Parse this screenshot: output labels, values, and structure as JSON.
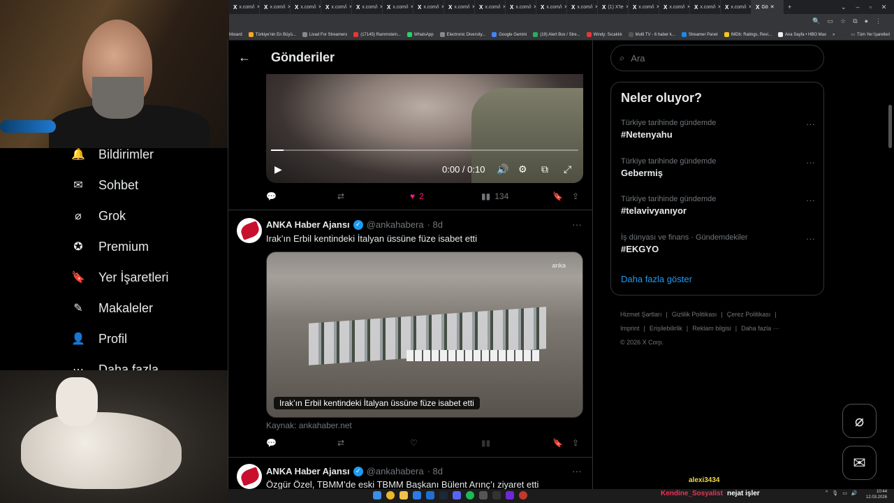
{
  "browser": {
    "tabs": [
      "x.com/i",
      "x.com/i",
      "x.com/i",
      "x.com/i",
      "x.com/i",
      "x.com/i",
      "x.com/i",
      "x.com/i",
      "x.com/i",
      "x.com/i",
      "x.com/i",
      "x.com/i",
      "(1) X'te",
      "x.com/i",
      "x.com/i",
      "x.com/i",
      "x.com/i",
      "Gö"
    ],
    "new_tab": "+",
    "bookmarks": [
      "hboard",
      "Türkiye'nin En Büyü...",
      "Livad For Streamers",
      "(17145) Rammstein...",
      "WhatsApp",
      "Electronic Diversity...",
      "Google Gemini",
      "(19) Alert Box / Stre...",
      "Windy: Sıcaklık",
      "Multi TV - 6 haber k...",
      "Streamer Panel",
      "IMDb: Ratings, Revi...",
      "Ana Sayfa • HBO Max"
    ],
    "bookmarks_more": "»",
    "all_bookmarks": "Tüm Yer İşaretleri"
  },
  "sidebar": {
    "items": [
      {
        "label": "Bildirimler",
        "icon": "bell-icon"
      },
      {
        "label": "Sohbet",
        "icon": "mail-icon"
      },
      {
        "label": "Grok",
        "icon": "grok-icon"
      },
      {
        "label": "Premium",
        "icon": "premium-icon"
      },
      {
        "label": "Yer İşaretleri",
        "icon": "bookmark-icon"
      },
      {
        "label": "Makaleler",
        "icon": "article-icon"
      },
      {
        "label": "Profil",
        "icon": "person-icon"
      },
      {
        "label": "Daha fazla",
        "icon": "more-icon"
      }
    ]
  },
  "header": {
    "title": "Gönderiler"
  },
  "video_post": {
    "time": "0:00 / 0:10",
    "progress": 0.04,
    "likes": "2",
    "views": "134",
    "like_color": "#f91880"
  },
  "post1": {
    "name": "ANKA Haber Ajansı",
    "handle": "@ankahabera",
    "age": "· 8d",
    "text": "Irak’ın Erbil kentindeki İtalyan üssüne füze isabet etti",
    "card_logo": "anka",
    "card_caption": "Irak’ın Erbil kentindeki İtalyan üssüne füze isabet etti",
    "source": "Kaynak: ankahaber.net"
  },
  "post2": {
    "name": "ANKA Haber Ajansı",
    "handle": "@ankahabera",
    "age": "· 8d",
    "text": "Özgür Özel, TBMM’de eski TBMM Başkanı Bülent Arınç’ı ziyaret etti"
  },
  "search": {
    "placeholder": "Ara"
  },
  "trends": {
    "title": "Neler oluyor?",
    "items": [
      {
        "context": "Türkiye tarihinde gündemde",
        "topic": "#Netenyahu"
      },
      {
        "context": "Türkiye tarihinde gündemde",
        "topic": "Gebermiş"
      },
      {
        "context": "Türkiye tarihinde gündemde",
        "topic": "#telavivyanıyor"
      },
      {
        "context": "İş dünyası ve finans · Gündemdekiler",
        "topic": "#EKGYO"
      }
    ],
    "show_more": "Daha fazla göster"
  },
  "footer": {
    "links1": [
      "Hizmet Şartları",
      "|",
      "Gizlilik Politikası",
      "|",
      "Çerez Politikası",
      "|"
    ],
    "links2": [
      "Imprint",
      "|",
      "Erişilebilirlik",
      "|",
      "Reklam bilgisi",
      "|",
      "Daha fazla ···"
    ],
    "copyright": "© 2026 X Corp."
  },
  "stream": {
    "chat_user1": "alexi3434",
    "chat_user2": "Kendine_Sosyalist",
    "chat_msg2": "nejat işler"
  },
  "clock": {
    "time": "10:44",
    "date": "12.03.2026"
  },
  "colors": {
    "accent": "#1d9bf0",
    "text": "#e7e9ea",
    "muted": "#71767b",
    "border": "#2f3336"
  }
}
